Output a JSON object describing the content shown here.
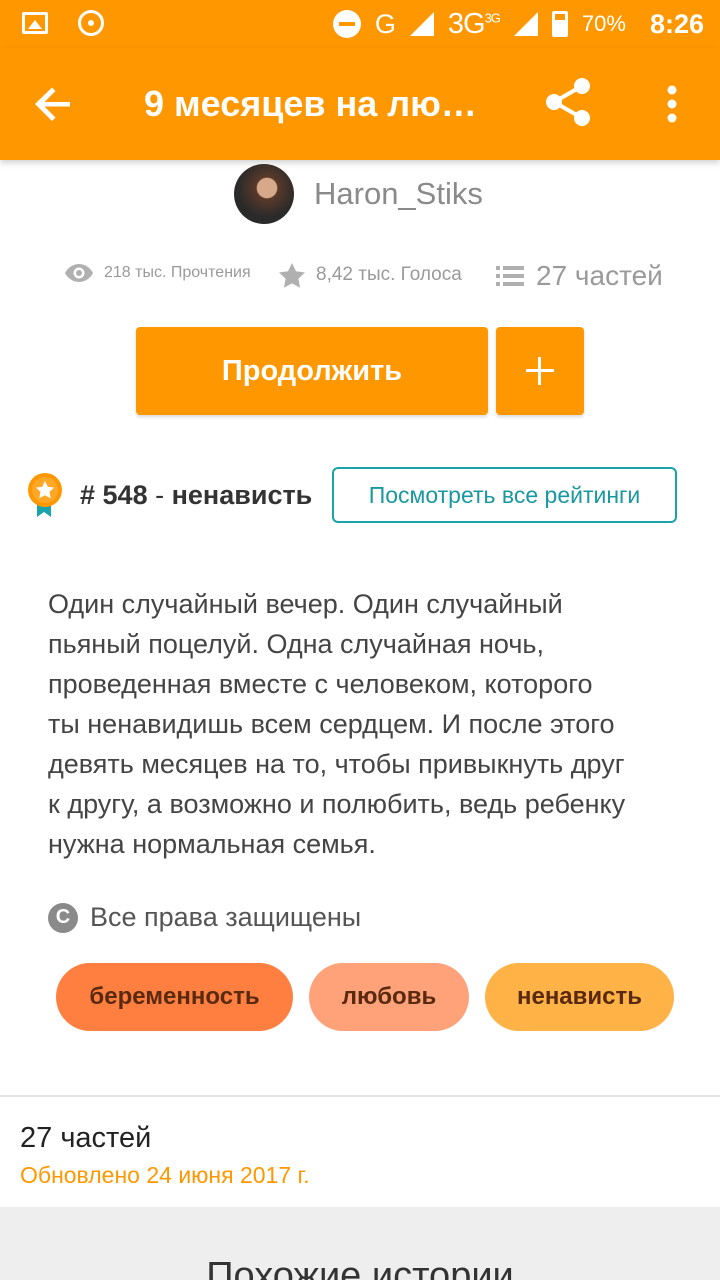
{
  "status_bar": {
    "network": "G",
    "network2": "3G",
    "network2_sup": "3G",
    "battery": "70%",
    "time": "8:26"
  },
  "app_bar": {
    "title": "9 месяцев на лю…",
    "back_icon": "arrow-left-icon",
    "share_icon": "share-icon",
    "menu_icon": "more-vertical-icon"
  },
  "author": {
    "name": "Haron_Stiks"
  },
  "stats": {
    "reads": "218 тыс. Прочтения",
    "votes": "8,42 тыс. Голоса",
    "parts": "27 частей"
  },
  "actions": {
    "continue_label": "Продолжить",
    "add_icon": "plus-icon"
  },
  "ranking": {
    "hash": "# ",
    "number": "548",
    "separator": " - ",
    "tag": "ненависть",
    "view_all_label": "Посмотреть все рейтинги"
  },
  "description": "Один случайный вечер. Один случайный\nпьяный  поцелуй. Одна случайная ночь,\nпроведенная вместе с человеком, которого\nты ненавидишь всем сердцем. И после этого\nдевять месяцев на то, чтобы привыкнуть друг\nк другу, а возможно и полюбить, ведь ребенку\nнужна нормальная семья.",
  "copyright": {
    "symbol": "C",
    "text": "Все права защищены"
  },
  "tags": [
    "беременность",
    "любовь",
    "ненависть"
  ],
  "parts_section": {
    "title": "27 частей",
    "updated": "Обновлено 24 июня 2017 г."
  },
  "similar": {
    "title": "Похожие истории"
  },
  "colors": {
    "accent": "#ff9800",
    "teal": "#1aa3a8",
    "tag1": "#ff7f40",
    "tag2": "#ffa27a",
    "tag3": "#ffb347"
  }
}
